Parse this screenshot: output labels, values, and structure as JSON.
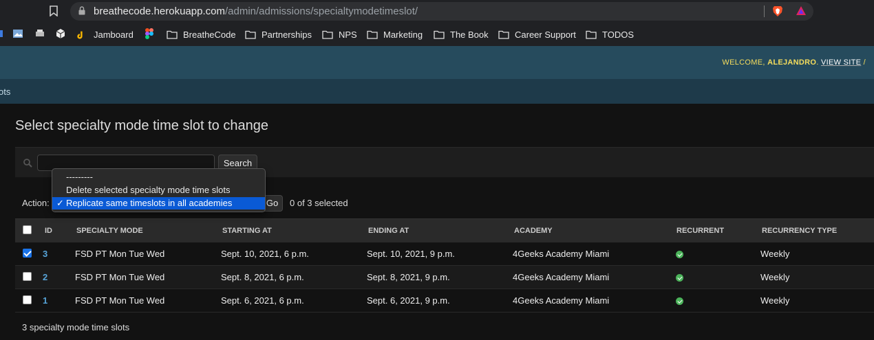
{
  "browser": {
    "url_host": "breathecode.herokuapp.com",
    "url_path": "/admin/admissions/specialtymodetimeslot/",
    "bookmarks": [
      {
        "label": "Jamboard"
      },
      {
        "label": "BreatheCode"
      },
      {
        "label": "Partnerships"
      },
      {
        "label": "NPS"
      },
      {
        "label": "Marketing"
      },
      {
        "label": "The Book"
      },
      {
        "label": "Career Support"
      },
      {
        "label": "TODOS"
      }
    ]
  },
  "header": {
    "welcome": "WELCOME, ",
    "user": "ALEJANDRO",
    "dot": ". ",
    "view_site": "VIEW SITE",
    "sep": " /"
  },
  "breadcrumb": "ots",
  "page_title": "Select specialty mode time slot to change",
  "search": {
    "button_label": "Search",
    "value": ""
  },
  "actions": {
    "label": "Action:",
    "go_label": "Go",
    "selected_count": "0 of 3 selected",
    "options": [
      {
        "label": "---------",
        "selected": false
      },
      {
        "label": "Delete selected specialty mode time slots",
        "selected": false
      },
      {
        "label": "Replicate same timeslots in all academies",
        "selected": true
      }
    ],
    "check_mark": "✓"
  },
  "table": {
    "headers": [
      "ID",
      "SPECIALTY MODE",
      "STARTING AT",
      "ENDING AT",
      "ACADEMY",
      "RECURRENT",
      "RECURRENCY TYPE"
    ],
    "rows": [
      {
        "checked": true,
        "id": "3",
        "mode": "FSD PT Mon Tue Wed",
        "start": "Sept. 10, 2021, 6 p.m.",
        "end": "Sept. 10, 2021, 9 p.m.",
        "academy": "4Geeks Academy Miami",
        "recurrent": true,
        "type": "Weekly"
      },
      {
        "checked": false,
        "id": "2",
        "mode": "FSD PT Mon Tue Wed",
        "start": "Sept. 8, 2021, 6 p.m.",
        "end": "Sept. 8, 2021, 9 p.m.",
        "academy": "4Geeks Academy Miami",
        "recurrent": true,
        "type": "Weekly"
      },
      {
        "checked": false,
        "id": "1",
        "mode": "FSD PT Mon Tue Wed",
        "start": "Sept. 6, 2021, 6 p.m.",
        "end": "Sept. 6, 2021, 9 p.m.",
        "academy": "4Geeks Academy Miami",
        "recurrent": true,
        "type": "Weekly"
      }
    ]
  },
  "paginator": "3 specialty mode time slots",
  "colors": {
    "header": "#264b5d",
    "breadcrumbs": "#1e3a4a",
    "link": "#57a4d9",
    "selected_option": "#0a5ad5",
    "ok": "#4bb35a"
  }
}
